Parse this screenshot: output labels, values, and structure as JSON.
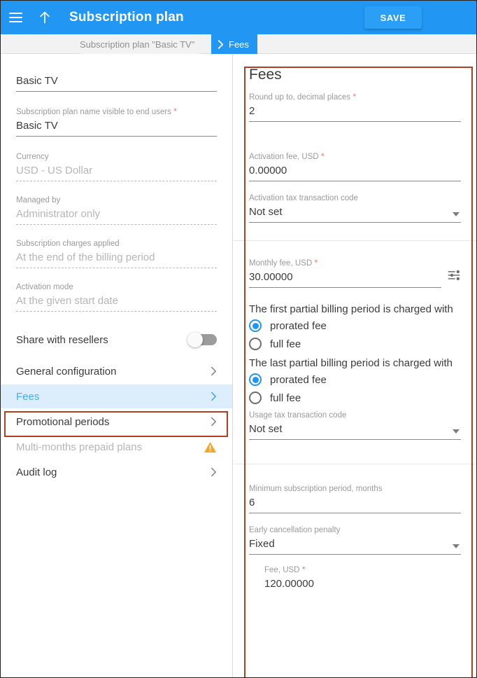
{
  "appbar": {
    "menu_icon": "hamburger-menu-icon",
    "up_icon": "arrow-up-icon",
    "title": "Subscription plan",
    "save_label": "SAVE"
  },
  "breadcrumb": {
    "parent": "Subscription plan \"Basic TV\"",
    "chevron_icon": "chevron-right-icon",
    "current": "Fees"
  },
  "left_panel": {
    "fields": [
      {
        "label": "",
        "value": "Basic TV",
        "required": false,
        "readonly": false,
        "style": "solid"
      },
      {
        "label": "Subscription plan name visible to end users",
        "value": "Basic TV",
        "required": true,
        "readonly": false,
        "style": "solid"
      },
      {
        "label": "Currency",
        "value": "USD - US Dollar",
        "required": false,
        "readonly": true,
        "style": "dashed"
      },
      {
        "label": "Managed by",
        "value": "Administrator only",
        "required": false,
        "readonly": true,
        "style": "dashed"
      },
      {
        "label": "Subscription charges applied",
        "value": "At the end of the billing period",
        "required": false,
        "readonly": true,
        "style": "dashed"
      },
      {
        "label": "Activation mode",
        "value": "At the given start date",
        "required": false,
        "readonly": true,
        "style": "dashed"
      }
    ],
    "share_toggle": {
      "label": "Share with resellers",
      "state": "off"
    },
    "nav_items": [
      {
        "label": "General configuration",
        "trailing": "chevron-right-icon",
        "state": "normal"
      },
      {
        "label": "Fees",
        "trailing": "chevron-right-icon",
        "state": "selected"
      },
      {
        "label": "Promotional periods",
        "trailing": "chevron-right-icon",
        "state": "normal"
      },
      {
        "label": "Multi-months prepaid plans",
        "trailing": "warning-triangle-icon",
        "state": "disabled"
      },
      {
        "label": "Audit log",
        "trailing": "chevron-right-icon",
        "state": "normal"
      }
    ]
  },
  "right_panel": {
    "title": "Fees",
    "group1": [
      {
        "label": "Round up to, decimal places",
        "value": "2",
        "required": true,
        "type": "text"
      },
      {
        "label": "Activation fee, USD",
        "value": "0.00000",
        "required": true,
        "type": "text"
      },
      {
        "label": "Activation tax transaction code",
        "value": "Not set",
        "required": false,
        "type": "select"
      }
    ],
    "monthly_fee": {
      "label": "Monthly fee, USD",
      "value": "30.00000",
      "required": true,
      "adornment_icon": "tune-sliders-icon"
    },
    "first_period": {
      "caption": "The first partial billing period is charged with",
      "options": [
        {
          "label": "prorated fee",
          "selected": true
        },
        {
          "label": "full fee",
          "selected": false
        }
      ]
    },
    "last_period": {
      "caption": "The last partial billing period is charged with",
      "options": [
        {
          "label": "prorated fee",
          "selected": true
        },
        {
          "label": "full fee",
          "selected": false
        }
      ]
    },
    "usage_tax": {
      "label": "Usage tax transaction code",
      "value": "Not set",
      "required": false,
      "type": "select"
    },
    "group3": [
      {
        "label": "Minimum subscription period, months",
        "value": "6",
        "required": false,
        "type": "text"
      },
      {
        "label": "Early cancellation penalty",
        "value": "Fixed",
        "required": false,
        "type": "select"
      },
      {
        "label": "Fee, USD",
        "value": "120.00000",
        "required": true,
        "type": "text",
        "indent": true
      }
    ]
  },
  "colors": {
    "accent": "#2196f3",
    "selected_row": "#dceefc",
    "required_star": "#f4736b",
    "warning": "#f5a623",
    "annotation": "#b1401f"
  }
}
